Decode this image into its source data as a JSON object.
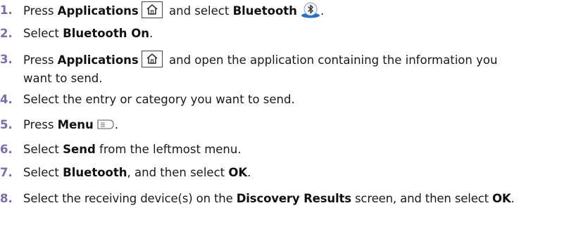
{
  "steps": [
    {
      "num": "1.",
      "text": [
        "Press ",
        "Applications",
        " and select ",
        "Bluetooth",
        "."
      ]
    },
    {
      "num": "2.",
      "text": [
        "Select ",
        "Bluetooth On",
        "."
      ]
    },
    {
      "num": "3.",
      "text": [
        "Press ",
        "Applications",
        " and open the application containing the information you",
        "want to send."
      ]
    },
    {
      "num": "4.",
      "text": [
        "Select the entry or category you want to send."
      ]
    },
    {
      "num": "5.",
      "text": [
        "Press ",
        "Menu",
        "."
      ]
    },
    {
      "num": "6.",
      "text": [
        "Select ",
        "Send",
        " from the leftmost menu."
      ]
    },
    {
      "num": "7.",
      "text": [
        "Select ",
        "Bluetooth",
        ", and then select ",
        "OK",
        "."
      ]
    },
    {
      "num": "8.",
      "text": [
        "Select the receiving device(s) on the ",
        "Discovery Results",
        " screen, and then select ",
        "OK",
        "."
      ]
    }
  ],
  "icons": {
    "home": "home-icon",
    "bluetooth": "bluetooth-icon",
    "menu": "menu-icon"
  },
  "colors": {
    "step_number": "#7d6aa8",
    "bluetooth_blue": "#2a6fc4"
  }
}
